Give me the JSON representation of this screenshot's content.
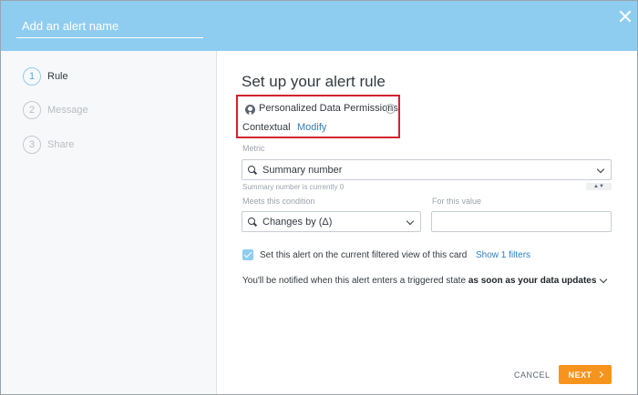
{
  "header": {
    "alert_name_placeholder": "Add an alert name"
  },
  "steps": [
    {
      "number": "1",
      "label": "Rule",
      "active": true
    },
    {
      "number": "2",
      "label": "Message",
      "active": false
    },
    {
      "number": "3",
      "label": "Share",
      "active": false
    }
  ],
  "main": {
    "title": "Set up your alert rule",
    "permissions": {
      "title": "Personalized Data Permissions",
      "value": "Contextual",
      "modify_label": "Modify"
    },
    "metric": {
      "label": "Metric",
      "value": "Summary number",
      "hint": "Summary number is currently 0"
    },
    "condition": {
      "label": "Meets this condition",
      "value": "Changes by (Δ)"
    },
    "value": {
      "label": "For this value",
      "current": ""
    },
    "filter_checkbox": {
      "label": "Set this alert on the current filtered view of this card",
      "checked": true,
      "link": "Show 1 filters"
    },
    "notify": {
      "prefix": "You'll be notified when this alert enters a triggered state",
      "emphasis": "as soon as your data updates"
    }
  },
  "footer": {
    "cancel_label": "CANCEL",
    "next_label": "NEXT"
  },
  "colors": {
    "header": "#8fcdf0",
    "accent_orange": "#f7941d",
    "link_blue": "#2f7fc1",
    "highlight_red": "#d3232f"
  },
  "icons": [
    "close-icon",
    "person-icon",
    "info-icon",
    "search-icon",
    "chevron-down-icon",
    "checkmark-icon",
    "chevron-right-icon"
  ]
}
